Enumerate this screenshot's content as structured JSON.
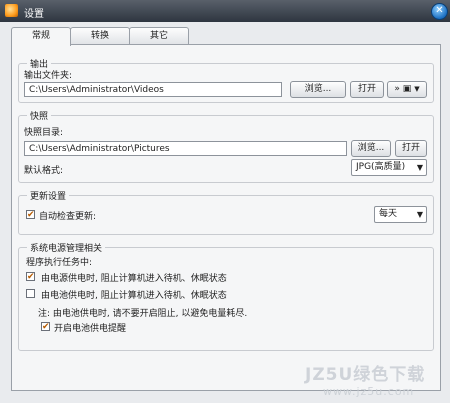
{
  "window": {
    "title": "设置"
  },
  "tabs": [
    {
      "label": "常规"
    },
    {
      "label": "转换"
    },
    {
      "label": "其它"
    }
  ],
  "output": {
    "group_title": "输出",
    "folder_label": "输出文件夹:",
    "folder_value": "C:\\Users\\Administrator\\Videos",
    "browse_label": "浏览...",
    "open_label": "打开",
    "device_glyph": "»",
    "device_icon": "floppy-icon"
  },
  "snapshot": {
    "group_title": "快照",
    "dir_label": "快照目录:",
    "dir_value": "C:\\Users\\Administrator\\Pictures",
    "browse_label": "浏览...",
    "open_label": "打开",
    "format_label": "默认格式:",
    "format_value": "JPG(高质量)"
  },
  "update": {
    "group_title": "更新设置",
    "auto_check_label": "自动检查更新:",
    "auto_check_checked": true,
    "frequency_value": "每天"
  },
  "power": {
    "group_title": "系统电源管理相关",
    "intro_label": "程序执行任务中:",
    "ac_label": "由电源供电时, 阻止计算机进入待机、休眠状态",
    "ac_checked": true,
    "battery_label": "由电池供电时, 阻止计算机进入待机、休眠状态",
    "battery_checked": false,
    "note": "注: 由电池供电时, 请不要开启阻止, 以避免电量耗尽.",
    "remind_label": "开启电池供电提醒",
    "remind_checked": true
  },
  "watermark": {
    "line1": "JZ5U绿色下载",
    "line2": "www.jz5u.com"
  },
  "colors": {
    "title_bar": "#2e3540",
    "panel": "#f5f6f7",
    "checkbox_mark": "#b55a00"
  }
}
